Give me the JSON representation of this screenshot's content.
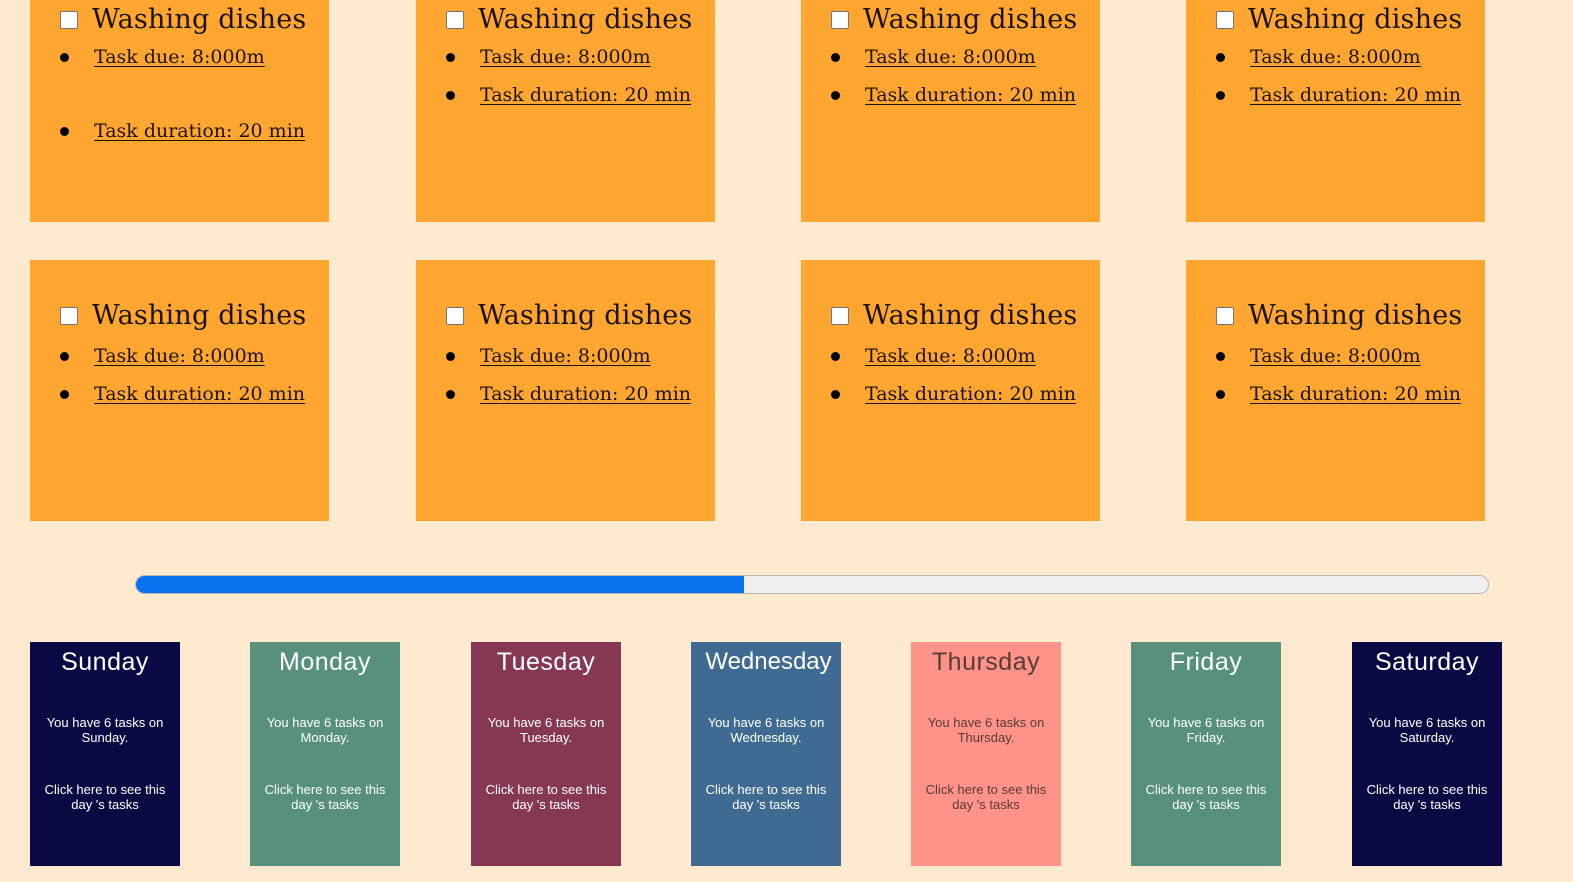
{
  "notes_row1": [
    {
      "title": "Washing dishes",
      "due": "Task due: 8:000m",
      "duration": "Task duration: 20 min"
    },
    {
      "title": "Washing dishes",
      "due": "Task due: 8:000m",
      "duration": "Task duration: 20 min"
    },
    {
      "title": "Washing dishes",
      "due": "Task due: 8:000m",
      "duration": "Task duration: 20 min"
    },
    {
      "title": "Washing dishes",
      "due": "Task due: 8:000m",
      "duration": "Task duration: 20 min"
    }
  ],
  "notes_row2": [
    {
      "title": "Washing dishes",
      "due": "Task due: 8:000m",
      "duration": "Task duration: 20 min"
    },
    {
      "title": "Washing dishes",
      "due": "Task due: 8:000m",
      "duration": "Task duration: 20 min"
    },
    {
      "title": "Washing dishes",
      "due": "Task due: 8:000m",
      "duration": "Task duration: 20 min"
    },
    {
      "title": "Washing dishes",
      "due": "Task due: 8:000m",
      "duration": "Task duration: 20 min"
    }
  ],
  "progress": {
    "fraction": 0.45,
    "fill_color": "#0b72ef"
  },
  "days": [
    {
      "name": "Sunday",
      "count_text": "You have 6 tasks on Sunday.",
      "link_text": "Click here to see this day 's tasks",
      "bg": "#0a0944",
      "fg": "#ffffff"
    },
    {
      "name": "Monday",
      "count_text": "You have 6 tasks on Monday.",
      "link_text": "Click here to see this day 's tasks",
      "bg": "#57917e",
      "fg": "#ffffff"
    },
    {
      "name": "Tuesday",
      "count_text": "You have 6 tasks on Tuesday.",
      "link_text": "Click here to see this day 's tasks",
      "bg": "#853754",
      "fg": "#ffffff"
    },
    {
      "name": "Wednesday",
      "count_text": "You have 6 tasks on Wednesday.",
      "link_text": "Click here to see this day 's tasks",
      "bg": "#3f6a91",
      "fg": "#ffffff"
    },
    {
      "name": "Thursday",
      "count_text": "You have 6 tasks on Thursday.",
      "link_text": "Click here to see this day 's tasks",
      "bg": "#ff938a",
      "fg": "#5a3a36"
    },
    {
      "name": "Friday",
      "count_text": "You have 6 tasks on Friday.",
      "link_text": "Click here to see this day 's tasks",
      "bg": "#57917e",
      "fg": "#ffffff"
    },
    {
      "name": "Saturday",
      "count_text": "You have 6 tasks on Saturday.",
      "link_text": "Click here to see this day 's tasks",
      "bg": "#0a0944",
      "fg": "#ffffff"
    }
  ],
  "icons": {
    "checkbox": "checkbox-icon",
    "bullet": "bullet-icon"
  },
  "colors": {
    "background": "#ffe9cf",
    "note": "#ffa630"
  }
}
